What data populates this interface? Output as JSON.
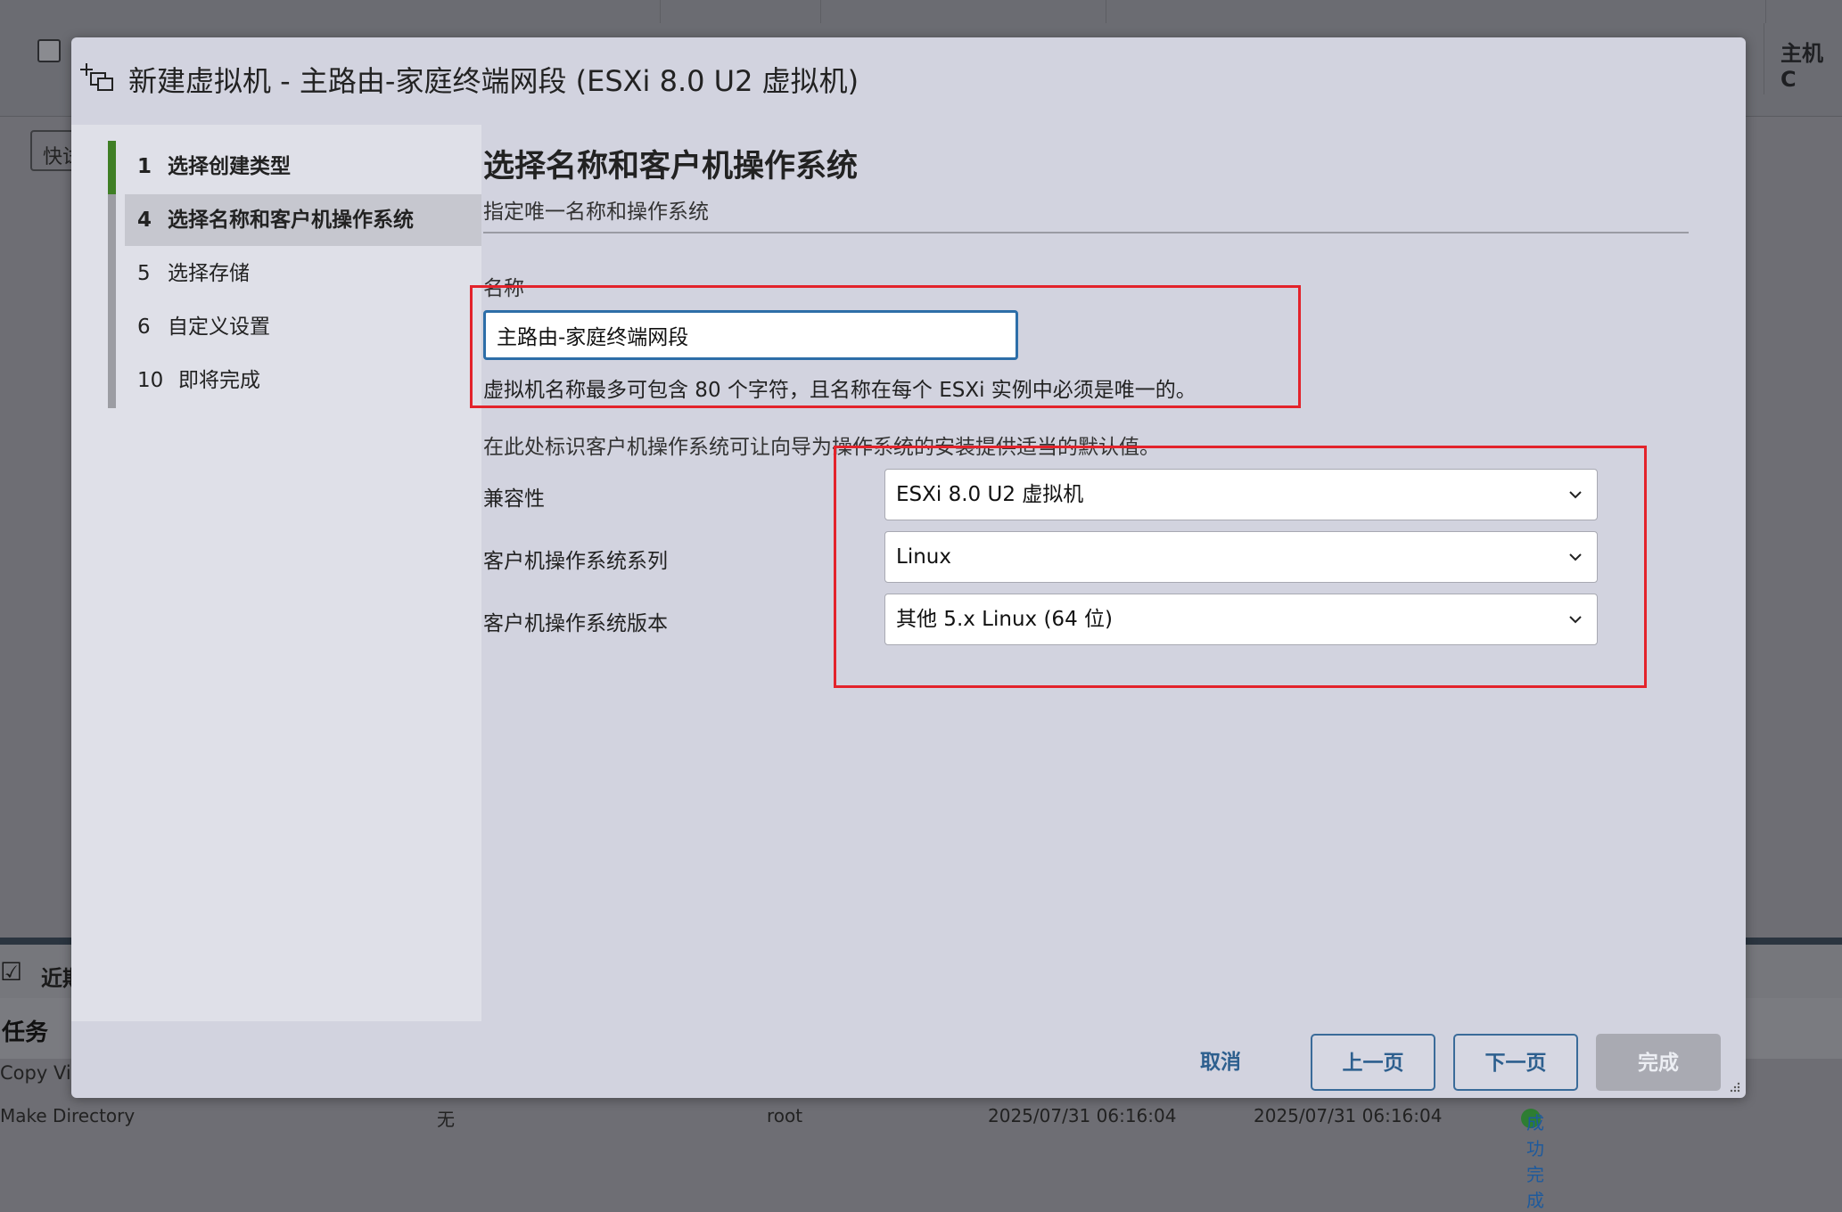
{
  "background": {
    "host_column_header": "主机 C",
    "quick_button": "快试",
    "recent_tasks_title": "近期任务",
    "tasks_header": "任务",
    "row1_task": "Copy Vi",
    "row2_task": "Make Directory",
    "row2_target": "无",
    "row2_user": "root",
    "row2_queued": "2025/07/31 06:16:04",
    "row2_started": "2025/07/31 06:16:04",
    "row2_status": "成功完成"
  },
  "modal": {
    "title": "新建虚拟机 - 主路由-家庭终端网段 (ESXi 8.0 U2 虚拟机)"
  },
  "wizard": {
    "steps": [
      {
        "num": "1",
        "label": "选择创建类型"
      },
      {
        "num": "4",
        "label": "选择名称和客户机操作系统"
      },
      {
        "num": "5",
        "label": "选择存储"
      },
      {
        "num": "6",
        "label": "自定义设置"
      },
      {
        "num": "10",
        "label": "即将完成"
      }
    ]
  },
  "page": {
    "title": "选择名称和客户机操作系统",
    "subtitle": "指定唯一名称和操作系统",
    "name_label": "名称",
    "name_value": "主路由-家庭终端网段",
    "name_hint": "虚拟机名称最多可包含 80 个字符，且名称在每个 ESXi 实例中必须是唯一的。",
    "guest_hint": "在此处标识客户机操作系统可让向导为操作系统的安装提供适当的默认值。",
    "compat_label": "兼容性",
    "compat_value": "ESXi 8.0 U2 虚拟机",
    "family_label": "客户机操作系统系列",
    "family_value": "Linux",
    "version_label": "客户机操作系统版本",
    "version_value": "其他 5.x Linux (64 位)"
  },
  "footer": {
    "cancel": "取消",
    "prev": "上一页",
    "next": "下一页",
    "finish": "完成"
  },
  "colors": {
    "annotation": "#e3232b",
    "accent": "#2d6ea8",
    "step_done": "#3f7f25"
  }
}
